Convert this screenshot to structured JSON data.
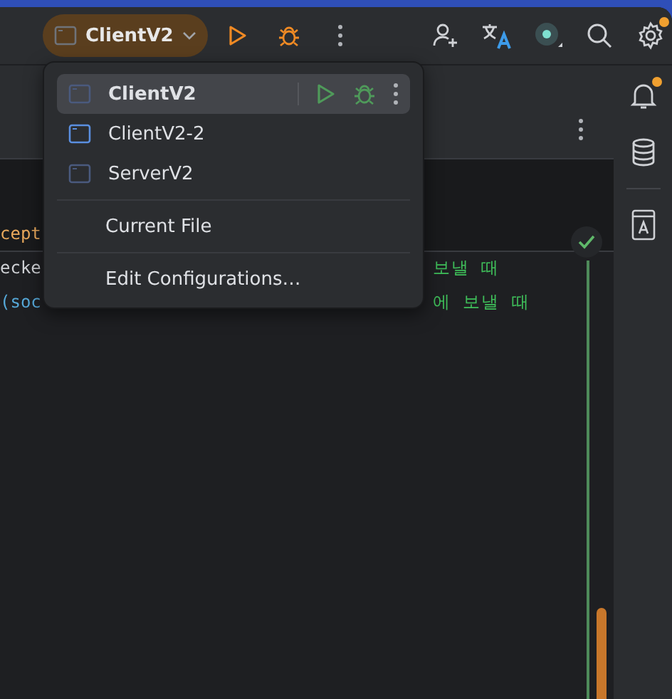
{
  "toolbar": {
    "run_config": "ClientV2",
    "notification_badge": true
  },
  "popup": {
    "items": [
      {
        "kind": "config",
        "label": "ClientV2",
        "selected": true,
        "color": "#4a5a7e"
      },
      {
        "kind": "config",
        "label": "ClientV2-2",
        "selected": false,
        "color": "#5a8fe0"
      },
      {
        "kind": "config",
        "label": "ServerV2",
        "selected": false,
        "color": "#4a5a7e"
      },
      {
        "kind": "separator"
      },
      {
        "kind": "action",
        "label": "Current File",
        "selected": false
      },
      {
        "kind": "separator"
      },
      {
        "kind": "action",
        "label": "Edit Configurations…",
        "selected": false
      }
    ]
  },
  "code_lines": [
    {
      "kind": "keyword",
      "left": "cept"
    },
    {
      "kind": "plain",
      "left": "ecke",
      "right": "보낼 때"
    },
    {
      "kind": "paren",
      "left": "(soc",
      "right": "에 보낼 때"
    }
  ],
  "sidebar": {
    "bell_badge": true
  }
}
